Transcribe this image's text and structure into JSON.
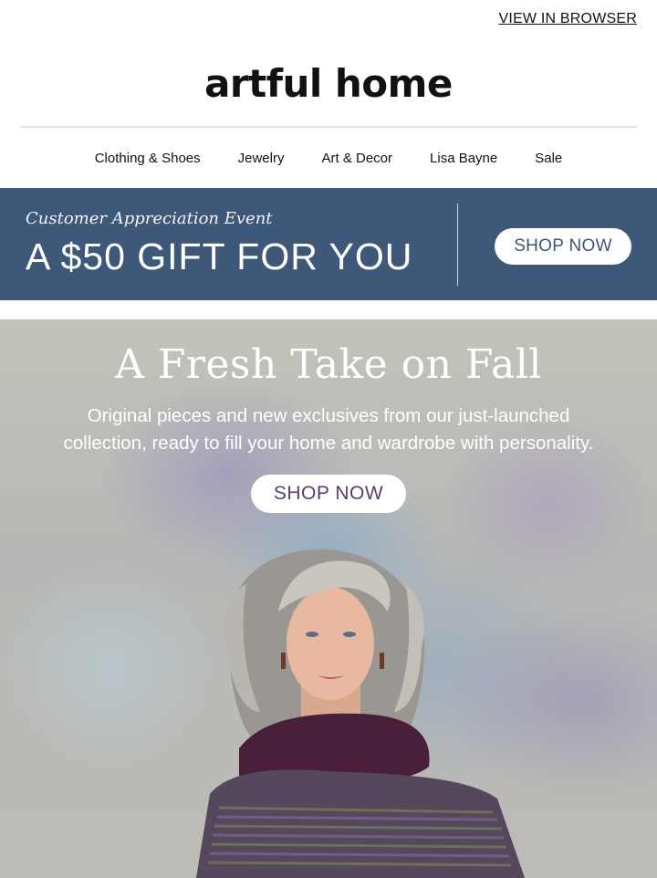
{
  "header": {
    "view_in_browser": "VIEW IN BROWSER",
    "logo_text": "artful home"
  },
  "nav": {
    "items": [
      "Clothing & Shoes",
      "Jewelry",
      "Art & Decor",
      "Lisa Bayne",
      "Sale"
    ]
  },
  "promo": {
    "kicker": "Customer Appreciation Event",
    "headline": "A $50 GIFT FOR YOU",
    "button_label": "SHOP NOW",
    "background_color": "#3e5879"
  },
  "hero": {
    "title": "A Fresh Take on Fall",
    "body_line1": "Original pieces and new exclusives from our just-launched",
    "body_line2": "collection, ready to fill your home and wardrobe with personality.",
    "button_label": "SHOP NOW",
    "sweater_color": "#4a1f3a"
  }
}
